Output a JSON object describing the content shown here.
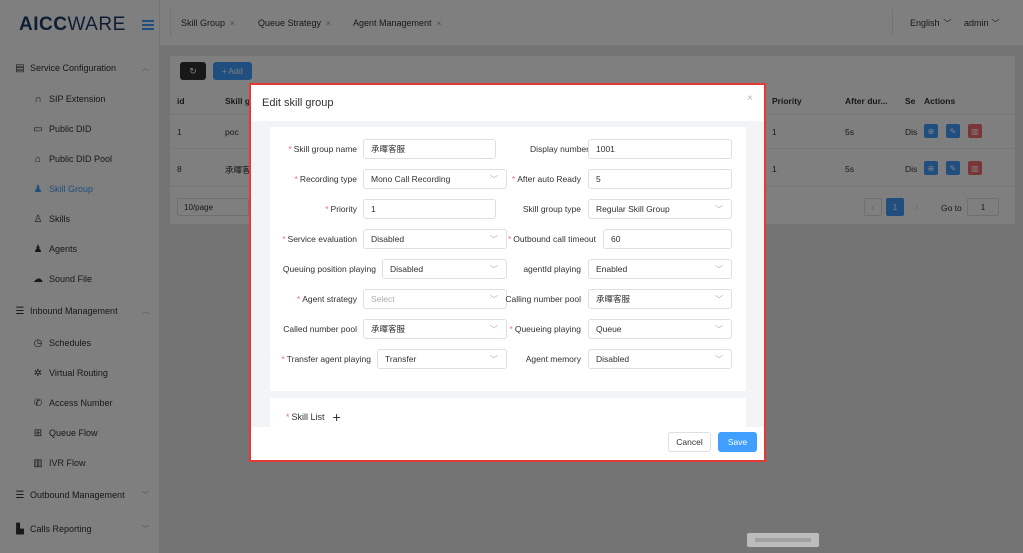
{
  "brand": {
    "logo_left": "AICC",
    "logo_right": "WARE"
  },
  "sidebar": {
    "groups": [
      {
        "label": "Service Configuration",
        "icon": "id-card-icon",
        "caret": "^"
      },
      {
        "label": "Inbound Management",
        "icon": "list-icon",
        "caret": "^"
      },
      {
        "label": "Outbound Management",
        "icon": "list-icon",
        "caret": "v"
      },
      {
        "label": "Calls Reporting",
        "icon": "bar-chart-icon",
        "caret": "v"
      }
    ],
    "items": [
      {
        "label": "SIP Extension",
        "icon": "headset-icon"
      },
      {
        "label": "Public DID",
        "icon": "folder-icon"
      },
      {
        "label": "Public DID Pool",
        "icon": "home-icon"
      },
      {
        "label": "Skill Group",
        "icon": "user-icon",
        "active": true
      },
      {
        "label": "Skills",
        "icon": "person-outline-icon"
      },
      {
        "label": "Agents",
        "icon": "user-icon"
      },
      {
        "label": "Sound File",
        "icon": "cloud-icon"
      },
      {
        "label": "Schedules",
        "icon": "clock-icon"
      },
      {
        "label": "Virtual Routing",
        "icon": "gear-icon"
      },
      {
        "label": "Access Number",
        "icon": "phone-icon"
      },
      {
        "label": "Queue Flow",
        "icon": "queue-icon"
      },
      {
        "label": "IVR Flow",
        "icon": "ivr-icon"
      }
    ]
  },
  "tabs": [
    {
      "label": "Skill Group",
      "close": "×"
    },
    {
      "label": "Queue Strategy",
      "close": "×"
    },
    {
      "label": "Agent Management",
      "close": "×"
    }
  ],
  "topbar": {
    "language": "English",
    "user": "admin"
  },
  "toolbar": {
    "add_label": "+ Add"
  },
  "table": {
    "headers": [
      "id",
      "Skill g",
      "Priority",
      "After dur...",
      "Se",
      "Actions"
    ],
    "rows": [
      {
        "id": "1",
        "name": "poc",
        "priority": "1",
        "after": "5s",
        "se": "Dis"
      },
      {
        "id": "8",
        "name": "承暉客",
        "priority": "1",
        "after": "5s",
        "se": "Dis"
      }
    ]
  },
  "pagination": {
    "page_size": "10/page",
    "current": "1",
    "goto_label": "Go to",
    "goto_value": "1"
  },
  "dialog": {
    "title": "Edit skill group",
    "close": "×",
    "fields": [
      {
        "label": "Skill group name",
        "required": true,
        "value": "承暉客服",
        "select": false
      },
      {
        "label": "Display number",
        "required": false,
        "value": "1001",
        "select": false
      },
      {
        "label": "Recording type",
        "required": true,
        "value": "Mono Call Recording",
        "select": true
      },
      {
        "label": "After auto Ready",
        "required": true,
        "value": "5",
        "select": false
      },
      {
        "label": "Priority",
        "required": true,
        "value": "1",
        "select": false
      },
      {
        "label": "Skill group type",
        "required": false,
        "value": "Regular Skill Group",
        "select": true
      },
      {
        "label": "Service evaluation",
        "required": true,
        "value": "Disabled",
        "select": true
      },
      {
        "label": "Outbound call timeout",
        "required": true,
        "value": "60",
        "select": false
      },
      {
        "label": "Queuing position playing",
        "required": false,
        "value": "Disabled",
        "select": true
      },
      {
        "label": "agentId playing",
        "required": false,
        "value": "Enabled",
        "select": true
      },
      {
        "label": "Agent strategy",
        "required": true,
        "value": "",
        "placeholder": "Select",
        "select": true
      },
      {
        "label": "Calling number pool",
        "required": false,
        "value": "承暉客服",
        "select": true
      },
      {
        "label": "Called number pool",
        "required": false,
        "value": "承暉客服",
        "select": true
      },
      {
        "label": "Queueing playing",
        "required": true,
        "value": "Queue",
        "select": true
      },
      {
        "label": "Transfer agent playing",
        "required": true,
        "value": "Transfer",
        "select": true
      },
      {
        "label": "Agent memory",
        "required": false,
        "value": "Disabled",
        "select": true
      }
    ],
    "skill_list_label": "Skill List",
    "skill_list_plus": "+",
    "cancel_label": "Cancel",
    "save_label": "Save"
  },
  "colors": {
    "primary": "#409eff",
    "danger": "#f56c6c",
    "dark_button": "#303133",
    "highlight_border": "#e53935",
    "brand": "#1f3a66"
  }
}
